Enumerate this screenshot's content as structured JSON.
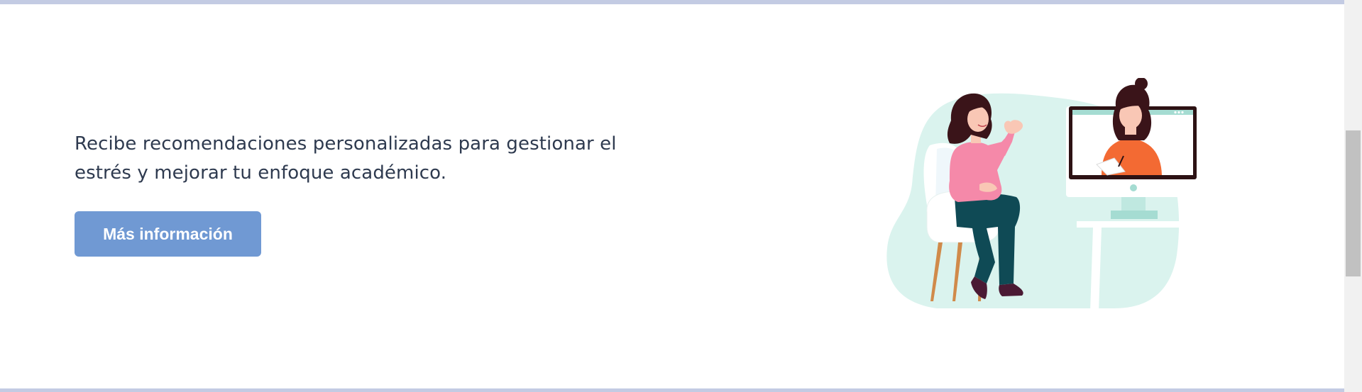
{
  "section": {
    "description": "Recibe recomendaciones personalizadas para gestionar el estrés y mejorar tu enfoque académico.",
    "button_label": "Más información"
  },
  "colors": {
    "border": "#c3cbe3",
    "button_bg": "#7099d3",
    "text": "#2e3a4f",
    "blob": "#daf3ee",
    "shirt_pink": "#f589a9",
    "shirt_orange": "#f36a33",
    "pants": "#0f4a55",
    "hair": "#3a1419"
  },
  "illustration": {
    "icon": "online-therapy-illustration"
  }
}
